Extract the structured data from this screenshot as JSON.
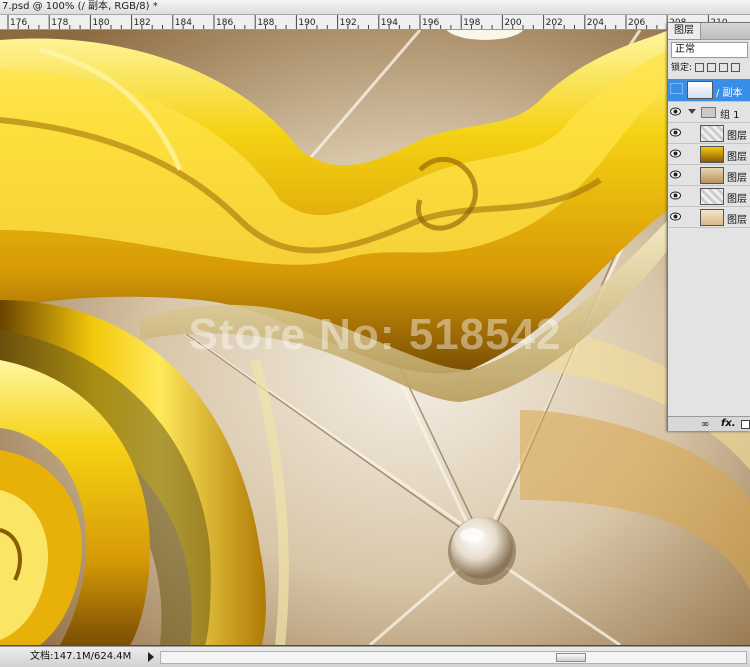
{
  "document": {
    "title": "7.psd @ 100% (/ 副本, RGB/8) *",
    "ruler_labels": [
      "176",
      "178",
      "180",
      "182",
      "184",
      "186",
      "188",
      "190",
      "192",
      "194",
      "196",
      "198",
      "200",
      "202",
      "204",
      "206",
      "208",
      "210"
    ]
  },
  "canvas": {
    "watermark": "Store No: 518542"
  },
  "status_bar": {
    "doc_info": "文档:147.1M/624.4M"
  },
  "layers_panel": {
    "tab_label": "图层",
    "blend_mode": "正常",
    "lock_label": "锁定:",
    "layers": [
      {
        "name": "/ 副本",
        "selected": true,
        "visible": false,
        "kind": "layer"
      },
      {
        "name": "组 1",
        "selected": false,
        "visible": true,
        "kind": "group"
      },
      {
        "name": "图层",
        "selected": false,
        "visible": true,
        "kind": "layer"
      },
      {
        "name": "图层",
        "selected": false,
        "visible": true,
        "kind": "layer"
      },
      {
        "name": "图层",
        "selected": false,
        "visible": true,
        "kind": "layer"
      },
      {
        "name": "图层",
        "selected": false,
        "visible": true,
        "kind": "layer"
      },
      {
        "name": "图层",
        "selected": false,
        "visible": true,
        "kind": "layer"
      }
    ],
    "footer": {
      "link_glyph": "∞",
      "fx_label": "fx."
    }
  },
  "colors": {
    "gold": "#f2c60a",
    "gold_dark": "#8a5a05",
    "leather": "#c9b18a",
    "selection": "#3a8ee6"
  }
}
